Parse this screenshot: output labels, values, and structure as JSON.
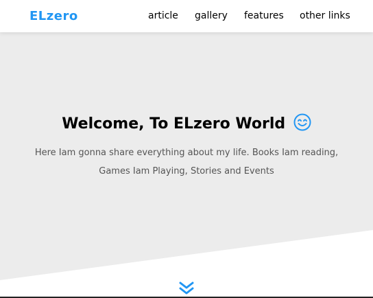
{
  "header": {
    "logo": "ELzero",
    "nav": [
      {
        "label": "article"
      },
      {
        "label": "gallery"
      },
      {
        "label": "features"
      },
      {
        "label": "other links"
      }
    ]
  },
  "landing": {
    "title": "Welcome, To ELzero World",
    "title_icon": "smiling-face-icon",
    "description": "Here Iam gonna share everything about my life. Books Iam reading, Games Iam Playing, Stories and Events",
    "scroll_icon": "double-chevron-down-icon"
  },
  "colors": {
    "accent": "#2196f3",
    "landing_bg": "#ececec",
    "text_dark": "#000000",
    "text_muted": "#555555"
  }
}
